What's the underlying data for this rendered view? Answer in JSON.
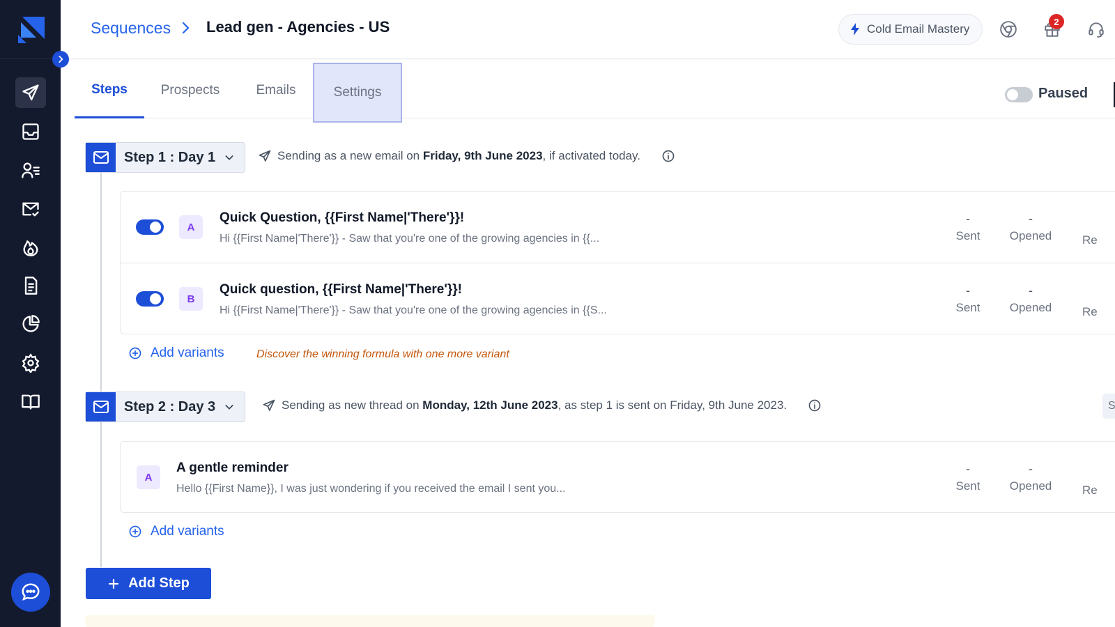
{
  "breadcrumb": {
    "parent": "Sequences",
    "current": "Lead gen - Agencies - US"
  },
  "header": {
    "mastery_label": "Cold Email Mastery",
    "gift_badge": "2"
  },
  "tabs": [
    "Steps",
    "Prospects",
    "Emails",
    "Settings"
  ],
  "status": {
    "label": "Paused"
  },
  "steps": [
    {
      "title": "Step 1 : Day 1",
      "info_prefix": "Sending as a new email on",
      "info_date": "Friday, 9th June 2023",
      "info_suffix": ", if activated today.",
      "variants": [
        {
          "letter": "A",
          "subject": "Quick Question, {{First Name|'There'}}!",
          "preview": "Hi {{First Name|'There'}}  - Saw that you're one of the growing agencies in {{...",
          "sent": "-",
          "opened": "-"
        },
        {
          "letter": "B",
          "subject": "Quick question, {{First Name|'There'}}!",
          "preview": "Hi {{First Name|'There'}} - Saw that you're one of the growing agencies in {{S...",
          "sent": "-",
          "opened": "-"
        }
      ],
      "add_variants": "Add variants",
      "tip": "Discover the winning formula with one more variant"
    },
    {
      "title": "Step 2 : Day 3",
      "info_prefix": "Sending as new thread on",
      "info_date": "Monday, 12th June 2023",
      "info_suffix": ", as step 1 is sent on Friday, 9th June 2023.",
      "variants": [
        {
          "letter": "A",
          "subject": "A gentle reminder",
          "preview": "Hello {{First Name}}, I was just wondering if you received the email I sent you...",
          "sent": "-",
          "opened": "-"
        }
      ],
      "add_variants": "Add variants"
    }
  ],
  "stat_labels": {
    "sent": "Sent",
    "opened": "Opened",
    "replied_partial": "Re"
  },
  "add_step_label": "Add Step",
  "edge_chip": "S",
  "colors": {
    "primary": "#1d4ed8",
    "sidebar": "#141a2e",
    "tip": "#c2560c",
    "variant_letter": "#7c3aed"
  }
}
